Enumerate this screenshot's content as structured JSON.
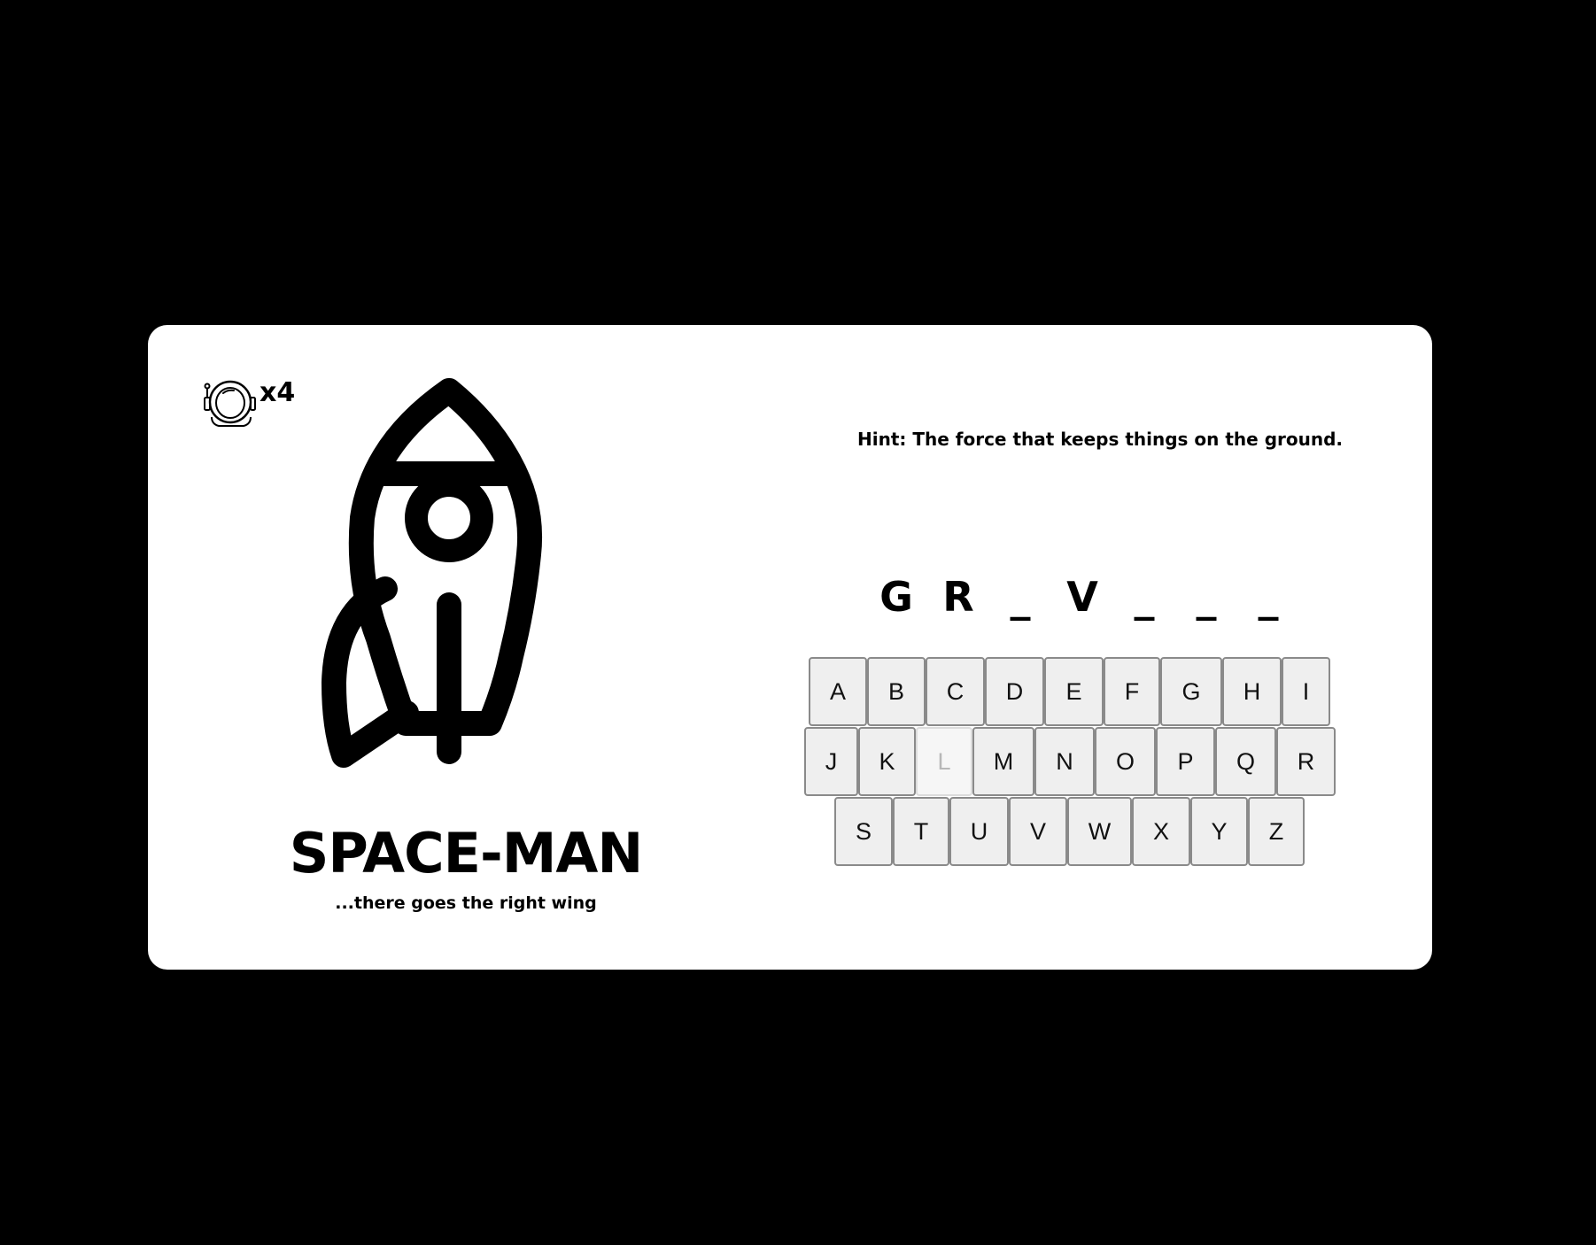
{
  "game": {
    "lives_count": "x4",
    "title": "SPACE-MAN",
    "subtitle": "...there goes the right wing",
    "hint": "Hint: The force that keeps things on the ground.",
    "word_slots": [
      "G",
      "R",
      "_",
      "V",
      "_",
      "_",
      "_"
    ]
  },
  "keyboard": {
    "row1": [
      {
        "label": "A",
        "used": false
      },
      {
        "label": "B",
        "used": false
      },
      {
        "label": "C",
        "used": false
      },
      {
        "label": "D",
        "used": false
      },
      {
        "label": "E",
        "used": false
      },
      {
        "label": "F",
        "used": false
      },
      {
        "label": "G",
        "used": false
      },
      {
        "label": "H",
        "used": false
      },
      {
        "label": "I",
        "used": false
      }
    ],
    "row2": [
      {
        "label": "J",
        "used": false
      },
      {
        "label": "K",
        "used": false
      },
      {
        "label": "L",
        "used": true
      },
      {
        "label": "M",
        "used": false
      },
      {
        "label": "N",
        "used": false
      },
      {
        "label": "O",
        "used": false
      },
      {
        "label": "P",
        "used": false
      },
      {
        "label": "Q",
        "used": false
      },
      {
        "label": "R",
        "used": false
      }
    ],
    "row3": [
      {
        "label": "S",
        "used": false
      },
      {
        "label": "T",
        "used": false
      },
      {
        "label": "U",
        "used": false
      },
      {
        "label": "V",
        "used": false
      },
      {
        "label": "W",
        "used": false
      },
      {
        "label": "X",
        "used": false
      },
      {
        "label": "Y",
        "used": false
      },
      {
        "label": "Z",
        "used": false
      }
    ]
  },
  "icons": {
    "lives": "astronaut-helmet-icon",
    "illustration": "rocket-icon"
  },
  "colors": {
    "background": "#000000",
    "card": "#ffffff",
    "key_fill": "#efefef",
    "key_border": "#8a8a8a",
    "used_key_text": "#b7b7b7"
  }
}
